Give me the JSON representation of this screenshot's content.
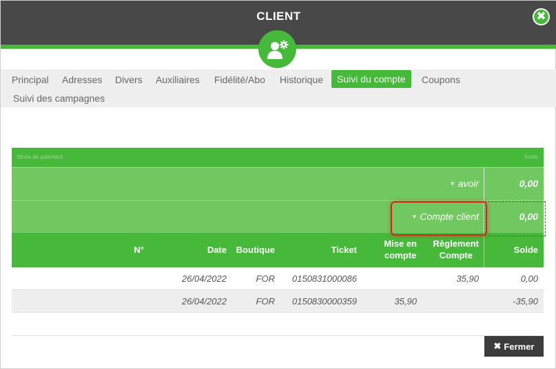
{
  "header": {
    "title": "CLIENT",
    "close_icon": "✖",
    "avatar_icon": "user-gear-icon"
  },
  "tabs": [
    {
      "label": "Principal",
      "active": false
    },
    {
      "label": "Adresses",
      "active": false
    },
    {
      "label": "Divers",
      "active": false
    },
    {
      "label": "Auxiliaires",
      "active": false
    },
    {
      "label": "Fidélité/Abo",
      "active": false
    },
    {
      "label": "Historique",
      "active": false
    },
    {
      "label": "Suivi du compte",
      "active": true
    },
    {
      "label": "Coupons",
      "active": false
    },
    {
      "label": "Suivi des campagnes",
      "active": false
    }
  ],
  "table": {
    "faint_left": "Mode de paiement",
    "faint_right": "Solde",
    "summary": [
      {
        "label": "avoir",
        "value": "0,00"
      },
      {
        "label": "Compte client",
        "value": "0,00"
      }
    ],
    "columns": {
      "num": "N°",
      "date": "Date",
      "boutique": "Boutique",
      "ticket": "Ticket",
      "mise_line1": "Mise en",
      "mise_line2": "compte",
      "reglement_line1": "Règlement",
      "reglement_line2": "Compte",
      "solde": "Solde"
    },
    "rows": [
      {
        "num": "",
        "date": "26/04/2022",
        "boutique": "FOR",
        "ticket": "0150831000086",
        "mise": "",
        "reglement": "35,90",
        "solde": "0,00"
      },
      {
        "num": "",
        "date": "26/04/2022",
        "boutique": "FOR",
        "ticket": "0150830000359",
        "mise": "35,90",
        "reglement": "",
        "solde": "-35,90"
      }
    ]
  },
  "footer": {
    "fermer_icon": "✖",
    "fermer_label": "Fermer"
  },
  "colors": {
    "accent": "#46b83a",
    "header_bg": "#484848",
    "highlight": "#d9241a"
  }
}
